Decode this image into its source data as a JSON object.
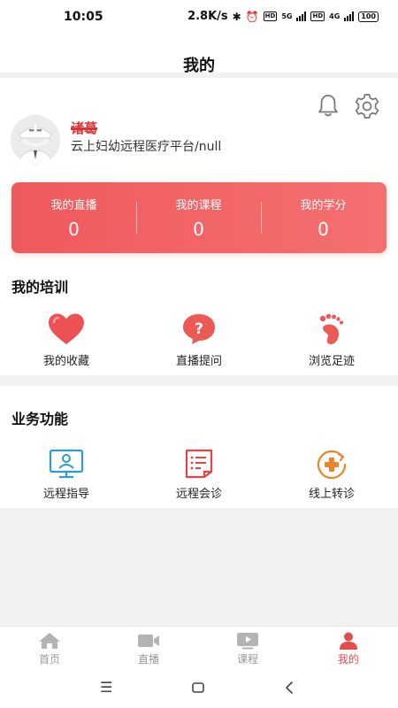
{
  "status_bar": {
    "time": "10:05",
    "speed": "2.8K/s",
    "net1": "5G",
    "net2": "4G",
    "battery": "100"
  },
  "header": {
    "title": "我的"
  },
  "profile": {
    "name": "诸葛",
    "organization": "云上妇幼远程医疗平台/null"
  },
  "stats": [
    {
      "label": "我的直播",
      "value": "0"
    },
    {
      "label": "我的课程",
      "value": "0"
    },
    {
      "label": "我的学分",
      "value": "0"
    }
  ],
  "training": {
    "title": "我的培训",
    "items": [
      {
        "label": "我的收藏",
        "icon": "heart-icon"
      },
      {
        "label": "直播提问",
        "icon": "question-bubble-icon"
      },
      {
        "label": "浏览足迹",
        "icon": "footprint-icon"
      }
    ]
  },
  "business": {
    "title": "业务功能",
    "items": [
      {
        "label": "远程指导",
        "icon": "monitor-user-icon"
      },
      {
        "label": "远程会诊",
        "icon": "document-list-icon"
      },
      {
        "label": "线上转诊",
        "icon": "referral-plus-icon"
      }
    ]
  },
  "bottom_nav": [
    {
      "label": "首页",
      "icon": "home-icon"
    },
    {
      "label": "直播",
      "icon": "video-camera-icon"
    },
    {
      "label": "课程",
      "icon": "play-screen-icon"
    },
    {
      "label": "我的",
      "icon": "person-icon",
      "active": true
    }
  ],
  "colors": {
    "accent": "#f0595c",
    "active_nav": "#e84b4b",
    "business_blue": "#2d9ad3",
    "business_orange": "#e8862a"
  }
}
